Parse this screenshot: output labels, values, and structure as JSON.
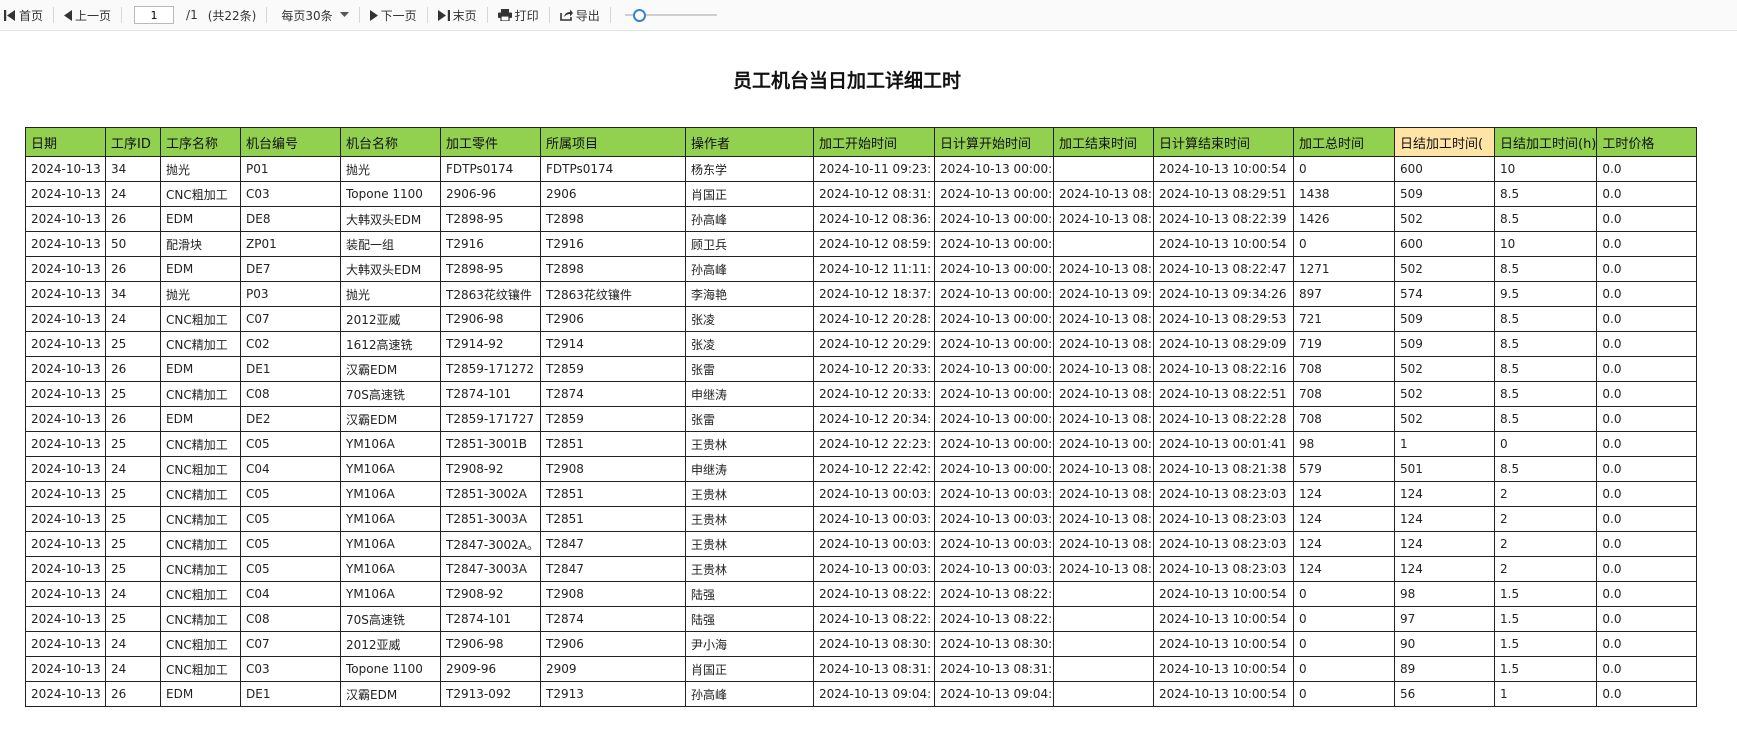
{
  "toolbar": {
    "first_label": "首页",
    "prev_label": "上一页",
    "page_value": "1",
    "page_total": "/1",
    "record_count": "(共22条)",
    "page_size_label": "每页30条",
    "next_label": "下一页",
    "last_label": "末页",
    "print_label": "打印",
    "export_label": "导出"
  },
  "report": {
    "title": "员工机台当日加工详细工时"
  },
  "table": {
    "headers": [
      "日期",
      "工序ID",
      "工序名称",
      "机台编号",
      "机台名称",
      "加工零件",
      "所属项目",
      "操作者",
      "加工开始时间",
      "日计算开始时间",
      "加工结束时间",
      "日计算结束时间",
      "加工总时间",
      "日结加工时间(",
      "日结加工时间(h)",
      "工时价格"
    ],
    "highlight_header_index": 13,
    "rows": [
      [
        "2024-10-13",
        "34",
        "抛光",
        "P01",
        "抛光",
        "FDTPs0174",
        "FDTPs0174",
        "杨东学",
        "2024-10-11 09:23:",
        "2024-10-13 00:00:",
        "",
        "2024-10-13 10:00:54",
        "0",
        "600",
        "10",
        "0.0"
      ],
      [
        "2024-10-13",
        "24",
        "CNC粗加工",
        "C03",
        "Topone 1100",
        "2906-96",
        "2906",
        "肖国正",
        "2024-10-12 08:31:",
        "2024-10-13 00:00:",
        "2024-10-13 08:",
        "2024-10-13 08:29:51",
        "1438",
        "509",
        "8.5",
        "0.0"
      ],
      [
        "2024-10-13",
        "26",
        "EDM",
        "DE8",
        "大韩双头EDM",
        "T2898-95",
        "T2898",
        "孙高峰",
        "2024-10-12 08:36:",
        "2024-10-13 00:00:",
        "2024-10-13 08:",
        "2024-10-13 08:22:39",
        "1426",
        "502",
        "8.5",
        "0.0"
      ],
      [
        "2024-10-13",
        "50",
        "配滑块",
        "ZP01",
        "装配一组",
        "T2916",
        "T2916",
        "顾卫兵",
        "2024-10-12 08:59:",
        "2024-10-13 00:00:",
        "",
        "2024-10-13 10:00:54",
        "0",
        "600",
        "10",
        "0.0"
      ],
      [
        "2024-10-13",
        "26",
        "EDM",
        "DE7",
        "大韩双头EDM",
        "T2898-95",
        "T2898",
        "孙高峰",
        "2024-10-12 11:11:",
        "2024-10-13 00:00:",
        "2024-10-13 08:",
        "2024-10-13 08:22:47",
        "1271",
        "502",
        "8.5",
        "0.0"
      ],
      [
        "2024-10-13",
        "34",
        "抛光",
        "P03",
        "抛光",
        "T2863花纹镶件",
        "T2863花纹镶件",
        "李海艳",
        "2024-10-12 18:37:",
        "2024-10-13 00:00:",
        "2024-10-13 09:",
        "2024-10-13 09:34:26",
        "897",
        "574",
        "9.5",
        "0.0"
      ],
      [
        "2024-10-13",
        "24",
        "CNC粗加工",
        "C07",
        "2012亚威",
        "T2906-98",
        "T2906",
        "张凌",
        "2024-10-12 20:28:",
        "2024-10-13 00:00:",
        "2024-10-13 08:",
        "2024-10-13 08:29:53",
        "721",
        "509",
        "8.5",
        "0.0"
      ],
      [
        "2024-10-13",
        "25",
        "CNC精加工",
        "C02",
        "1612高速铣",
        "T2914-92",
        "T2914",
        "张凌",
        "2024-10-12 20:29:",
        "2024-10-13 00:00:",
        "2024-10-13 08:",
        "2024-10-13 08:29:09",
        "719",
        "509",
        "8.5",
        "0.0"
      ],
      [
        "2024-10-13",
        "26",
        "EDM",
        "DE1",
        "汉霸EDM",
        "T2859-171272",
        "T2859",
        "张雷",
        "2024-10-12 20:33:",
        "2024-10-13 00:00:",
        "2024-10-13 08:",
        "2024-10-13 08:22:16",
        "708",
        "502",
        "8.5",
        "0.0"
      ],
      [
        "2024-10-13",
        "25",
        "CNC精加工",
        "C08",
        "70S高速铣",
        "T2874-101",
        "T2874",
        "申继涛",
        "2024-10-12 20:33:",
        "2024-10-13 00:00:",
        "2024-10-13 08:",
        "2024-10-13 08:22:51",
        "708",
        "502",
        "8.5",
        "0.0"
      ],
      [
        "2024-10-13",
        "26",
        "EDM",
        "DE2",
        "汉霸EDM",
        "T2859-171727",
        "T2859",
        "张雷",
        "2024-10-12 20:34:",
        "2024-10-13 00:00:",
        "2024-10-13 08:",
        "2024-10-13 08:22:28",
        "708",
        "502",
        "8.5",
        "0.0"
      ],
      [
        "2024-10-13",
        "25",
        "CNC精加工",
        "C05",
        "YM106A",
        "T2851-3001B",
        "T2851",
        "王贵林",
        "2024-10-12 22:23:",
        "2024-10-13 00:00:",
        "2024-10-13 00:",
        "2024-10-13 00:01:41",
        "98",
        "1",
        "0",
        "0.0"
      ],
      [
        "2024-10-13",
        "24",
        "CNC粗加工",
        "C04",
        "YM106A",
        "T2908-92",
        "T2908",
        "申继涛",
        "2024-10-12 22:42:",
        "2024-10-13 00:00:",
        "2024-10-13 08:",
        "2024-10-13 08:21:38",
        "579",
        "501",
        "8.5",
        "0.0"
      ],
      [
        "2024-10-13",
        "25",
        "CNC精加工",
        "C05",
        "YM106A",
        "T2851-3002A",
        "T2851",
        "王贵林",
        "2024-10-13 00:03:",
        "2024-10-13 00:03:",
        "2024-10-13 08:",
        "2024-10-13 08:23:03",
        "124",
        "124",
        "2",
        "0.0"
      ],
      [
        "2024-10-13",
        "25",
        "CNC精加工",
        "C05",
        "YM106A",
        "T2851-3003A",
        "T2851",
        "王贵林",
        "2024-10-13 00:03:",
        "2024-10-13 00:03:",
        "2024-10-13 08:",
        "2024-10-13 08:23:03",
        "124",
        "124",
        "2",
        "0.0"
      ],
      [
        "2024-10-13",
        "25",
        "CNC精加工",
        "C05",
        "YM106A",
        "T2847-3002A。",
        "T2847",
        "王贵林",
        "2024-10-13 00:03:",
        "2024-10-13 00:03:",
        "2024-10-13 08:",
        "2024-10-13 08:23:03",
        "124",
        "124",
        "2",
        "0.0"
      ],
      [
        "2024-10-13",
        "25",
        "CNC精加工",
        "C05",
        "YM106A",
        "T2847-3003A",
        "T2847",
        "王贵林",
        "2024-10-13 00:03:",
        "2024-10-13 00:03:",
        "2024-10-13 08:",
        "2024-10-13 08:23:03",
        "124",
        "124",
        "2",
        "0.0"
      ],
      [
        "2024-10-13",
        "24",
        "CNC粗加工",
        "C04",
        "YM106A",
        "T2908-92",
        "T2908",
        "陆强",
        "2024-10-13 08:22:",
        "2024-10-13 08:22:",
        "",
        "2024-10-13 10:00:54",
        "0",
        "98",
        "1.5",
        "0.0"
      ],
      [
        "2024-10-13",
        "25",
        "CNC精加工",
        "C08",
        "70S高速铣",
        "T2874-101",
        "T2874",
        "陆强",
        "2024-10-13 08:22:",
        "2024-10-13 08:22:",
        "",
        "2024-10-13 10:00:54",
        "0",
        "97",
        "1.5",
        "0.0"
      ],
      [
        "2024-10-13",
        "24",
        "CNC粗加工",
        "C07",
        "2012亚威",
        "T2906-98",
        "T2906",
        "尹小海",
        "2024-10-13 08:30:",
        "2024-10-13 08:30:",
        "",
        "2024-10-13 10:00:54",
        "0",
        "90",
        "1.5",
        "0.0"
      ],
      [
        "2024-10-13",
        "24",
        "CNC粗加工",
        "C03",
        "Topone 1100",
        "2909-96",
        "2909",
        "肖国正",
        "2024-10-13 08:31:",
        "2024-10-13 08:31:",
        "",
        "2024-10-13 10:00:54",
        "0",
        "89",
        "1.5",
        "0.0"
      ],
      [
        "2024-10-13",
        "26",
        "EDM",
        "DE1",
        "汉霸EDM",
        "T2913-092",
        "T2913",
        "孙高峰",
        "2024-10-13 09:04:",
        "2024-10-13 09:04:",
        "",
        "2024-10-13 10:00:54",
        "0",
        "56",
        "1",
        "0.0"
      ]
    ]
  },
  "colors": {
    "header_green": "#92d050",
    "header_highlight": "#ffe4a6",
    "slider_accent": "#3a82d6"
  }
}
